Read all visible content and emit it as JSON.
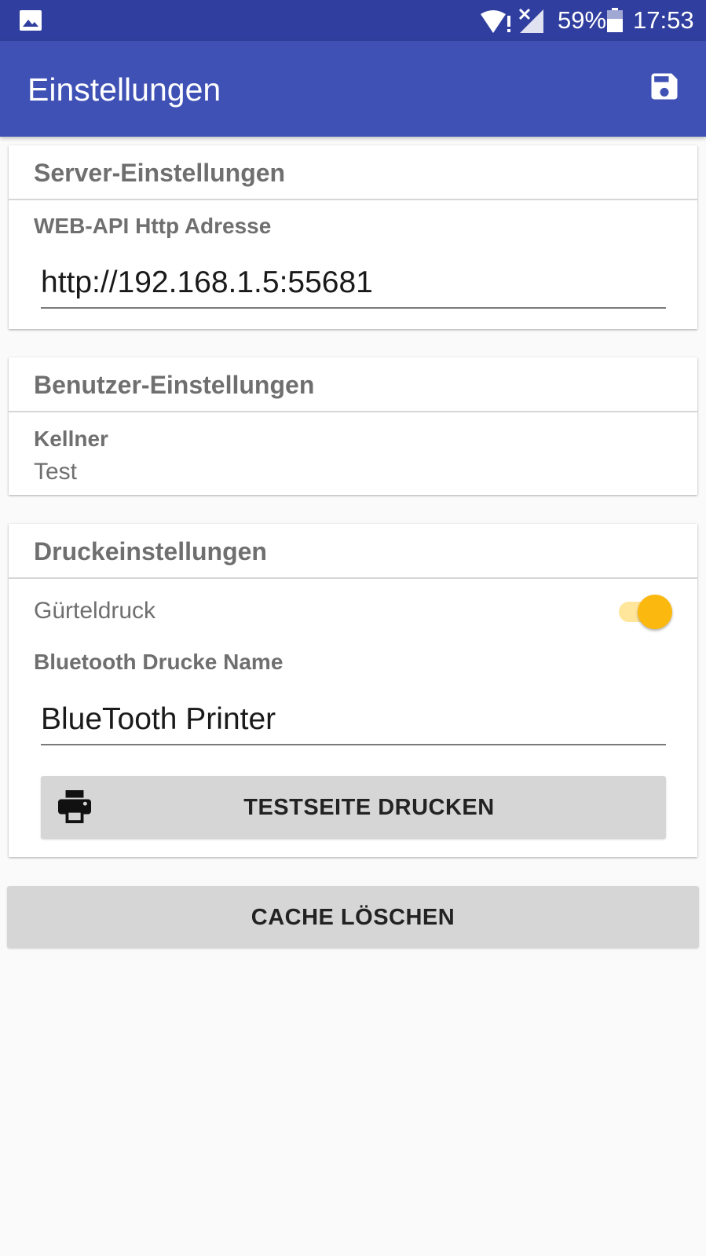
{
  "status_bar": {
    "gallery_icon": "image-icon",
    "wifi_icon": "wifi-alert-icon",
    "signal_icon": "no-signal-icon",
    "battery_percent": "59%",
    "battery_icon": "battery-icon",
    "time": "17:53"
  },
  "app_bar": {
    "title": "Einstellungen",
    "save_icon": "save-icon",
    "color": "#3f51b5"
  },
  "server_settings": {
    "title": "Server-Einstellungen",
    "api_label": "WEB-API Http Adresse",
    "api_value": "http://192.168.1.5:55681"
  },
  "user_settings": {
    "title": "Benutzer-Einstellungen",
    "waiter_label": "Kellner",
    "waiter_value": "Test"
  },
  "print_settings": {
    "title": "Druckeinstellungen",
    "belt_print_label": "Gürteldruck",
    "belt_print_enabled": true,
    "bt_label": "Bluetooth Drucke Name",
    "bt_value": "BlueTooth Printer",
    "test_button_label": "TESTSEITE DRUCKEN",
    "test_button_icon": "printer-icon"
  },
  "clear_cache_button_label": "CACHE LÖSCHEN",
  "accent_color": "#fbb80f"
}
